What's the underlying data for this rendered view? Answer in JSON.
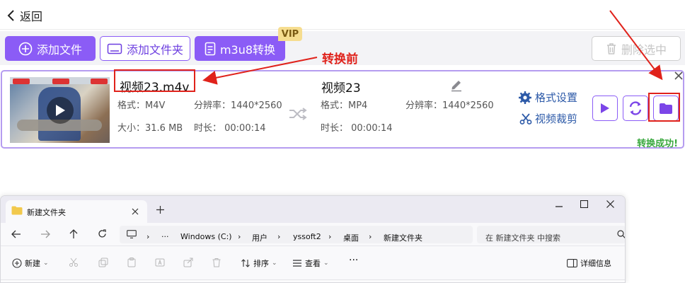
{
  "header": {
    "back_label": "返回"
  },
  "toolbar": {
    "add_file_label": "添加文件",
    "add_folder_label": "添加文件夹",
    "m3u8_label": "m3u8转换",
    "vip_badge": "VIP",
    "delete_label": "删除选中"
  },
  "annotation": {
    "before_label": "转换前"
  },
  "file_item": {
    "source": {
      "name": "视频23.m4v",
      "format": "格式：M4V",
      "resolution": "分辨率：1440*2560",
      "size": "大小：31.6 MB",
      "duration": "时长：  00:00:14"
    },
    "output": {
      "name": "视频23",
      "format": "格式：MP4",
      "resolution": "分辨率：1440*2560",
      "duration": "时长：  00:00:14"
    },
    "format_settings_label": "格式设置",
    "video_crop_label": "视频裁剪",
    "status": "转换成功!"
  },
  "colors": {
    "accent": "#8b5cf6",
    "annotation": "#e0221b",
    "success": "#39a83e"
  },
  "explorer": {
    "tab_title": "新建文件夹",
    "window_controls": [
      "minimize",
      "maximize",
      "close"
    ],
    "breadcrumbs": [
      "Windows (C:)",
      "用户",
      "yssoft2",
      "桌面",
      "新建文件夹"
    ],
    "search_placeholder": "在 新建文件夹 中搜索",
    "commands": {
      "new_label": "新建",
      "sort_label": "排序",
      "view_label": "查看",
      "details_label": "详细信息"
    }
  }
}
